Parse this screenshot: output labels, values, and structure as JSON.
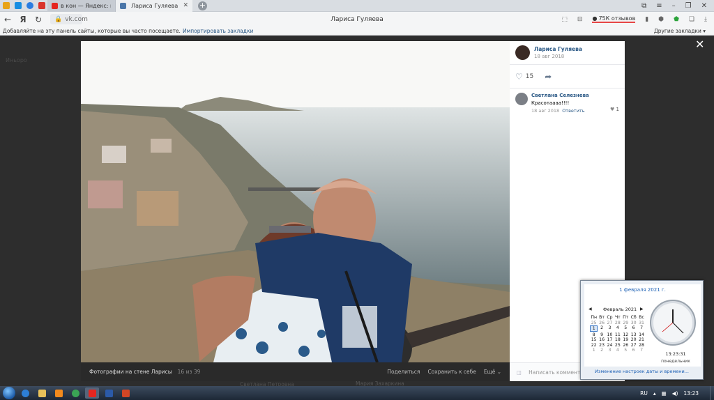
{
  "browser": {
    "tabs": [
      {
        "label": "в кон — Яндекс: нашлось",
        "active": false
      },
      {
        "label": "Лариса Гуляева",
        "active": true
      }
    ],
    "url": "vk.com",
    "page_title": "Лариса Гуляева",
    "reviews_label": "75К отзывов",
    "bookmarks_prompt": "Добавляйте на эту панель сайты, которые вы часто посещаете.",
    "bookmarks_import": "Импортировать закладки",
    "other_bookmarks": "Другие закладки"
  },
  "background": {
    "ghost_left": "Иньоро",
    "ghost_bottom1": "Светлана Петровна",
    "ghost_bottom2": "Мария Захаркина"
  },
  "viewer": {
    "album_caption": "Фотографии на стене Ларисы",
    "counter": "16 из 39",
    "actions": [
      "Поделиться",
      "Сохранить к себе",
      "Ещё"
    ],
    "owner_name": "Лариса Гуляева",
    "owner_date": "18 авг 2018",
    "likes": "15",
    "comment": {
      "author": "Светлана Селезнева",
      "text": "Красотаааа!!!!",
      "date": "18 авг 2018",
      "reply": "Ответить",
      "likes": "1"
    },
    "write_placeholder": "Написать комментарий..."
  },
  "calendar": {
    "full_date": "1 февраля 2021 г.",
    "month": "Февраль 2021",
    "weekdays": [
      "Пн",
      "Вт",
      "Ср",
      "Чт",
      "Пт",
      "Сб",
      "Вс"
    ],
    "days": [
      [
        "25",
        "26",
        "27",
        "28",
        "29",
        "30",
        "31"
      ],
      [
        "1",
        "2",
        "3",
        "4",
        "5",
        "6",
        "7"
      ],
      [
        "8",
        "9",
        "10",
        "11",
        "12",
        "13",
        "14"
      ],
      [
        "15",
        "16",
        "17",
        "18",
        "19",
        "20",
        "21"
      ],
      [
        "22",
        "23",
        "24",
        "25",
        "26",
        "27",
        "28"
      ],
      [
        "1",
        "2",
        "3",
        "4",
        "5",
        "6",
        "7"
      ]
    ],
    "time": "13:23:31",
    "weekday_name": "понедельник",
    "settings_link": "Изменение настроек даты и времени..."
  },
  "taskbar": {
    "lang": "RU",
    "clock": "13:23"
  }
}
